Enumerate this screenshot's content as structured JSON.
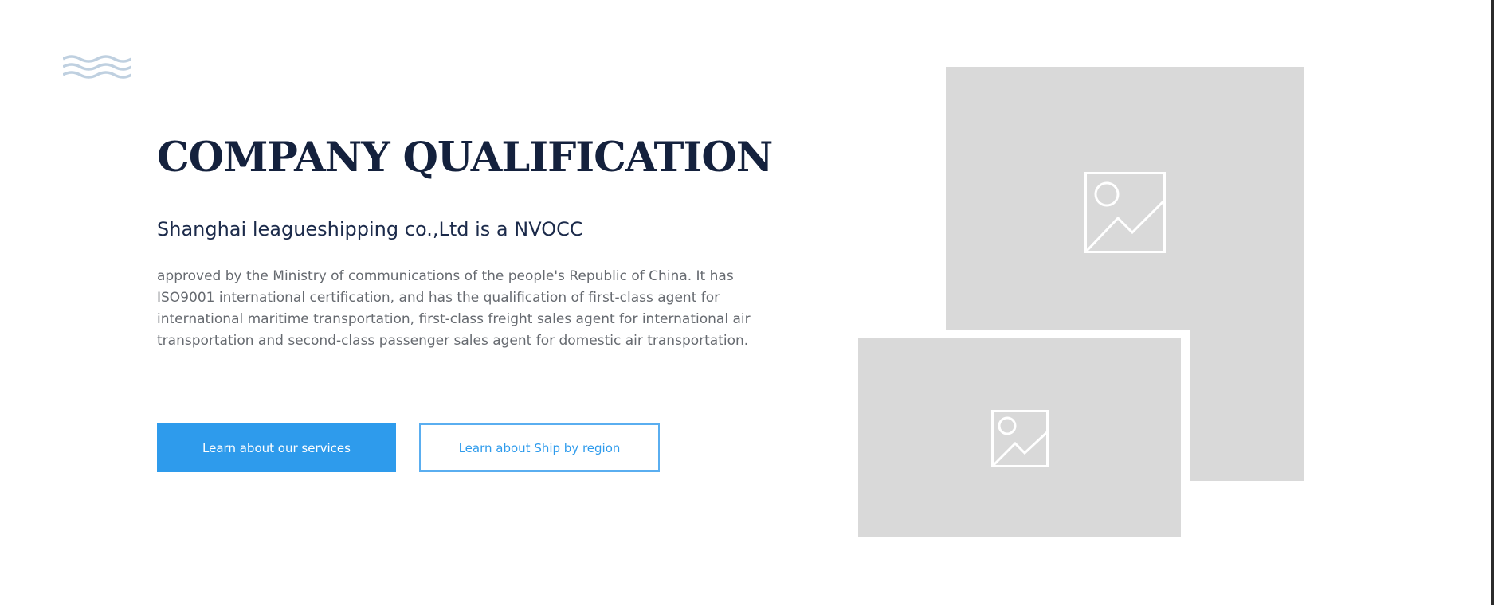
{
  "section": {
    "title": "COMPANY QUALIFICATION",
    "subtitle": "Shanghai leagueshipping co.,Ltd is a NVOCC",
    "description": "approved by the Ministry of communications of the people's Republic of China. It has ISO9001 international certification, and has the qualification of first-class agent for international maritime transportation, first-class freight sales agent for international air transportation and second-class passenger sales agent for domestic air transportation."
  },
  "buttons": {
    "services_label": "Learn about our services",
    "region_label": "Learn about Ship by region"
  },
  "decoration": {
    "wave_icon": "waves-icon",
    "wave_color": "#bfd0e0"
  },
  "images": {
    "large_placeholder_icon": "image-placeholder-icon",
    "small_placeholder_icon": "image-placeholder-icon",
    "placeholder_color": "#d9d9d9"
  },
  "colors": {
    "title": "#14213d",
    "accent": "#2e9bec",
    "body_text": "#666a70"
  }
}
